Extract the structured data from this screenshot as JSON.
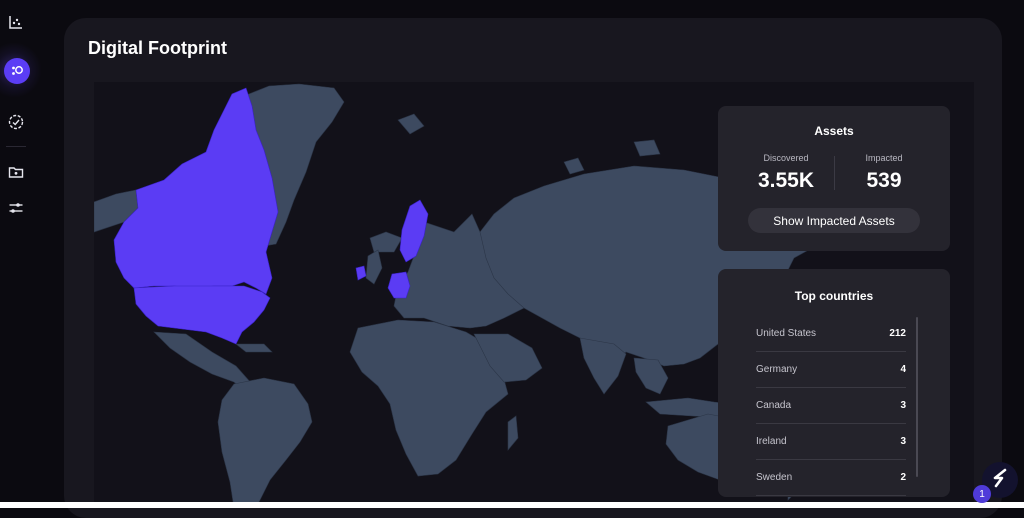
{
  "page": {
    "title": "Digital Footprint"
  },
  "sidebar": {
    "items": [
      {
        "icon": "chart-scatter-icon",
        "active": false
      },
      {
        "icon": "footprint-icon",
        "active": true
      },
      {
        "icon": "gear-badge-icon",
        "active": false
      },
      {
        "icon": "folder-icon",
        "active": false
      },
      {
        "icon": "sliders-icon",
        "active": false
      }
    ]
  },
  "assets": {
    "title": "Assets",
    "discovered_label": "Discovered",
    "discovered_value": "3.55K",
    "impacted_label": "Impacted",
    "impacted_value": "539",
    "button_label": "Show Impacted Assets"
  },
  "top_countries": {
    "title": "Top countries",
    "rows": [
      {
        "name": "United States",
        "count": "212"
      },
      {
        "name": "Germany",
        "count": "4"
      },
      {
        "name": "Canada",
        "count": "3"
      },
      {
        "name": "Ireland",
        "count": "3"
      },
      {
        "name": "Sweden",
        "count": "2"
      }
    ]
  },
  "map": {
    "highlighted_countries": [
      "United States",
      "Canada",
      "Germany",
      "Ireland",
      "Sweden"
    ],
    "highlight_color": "#5b3cf4",
    "land_color": "#3d4a60",
    "background_color": "#121119"
  },
  "fab": {
    "badge": "1",
    "icon": "assistant-logo-icon"
  },
  "colors": {
    "accent": "#5b3df5",
    "panel": "#18171f",
    "card": "#24232b"
  }
}
